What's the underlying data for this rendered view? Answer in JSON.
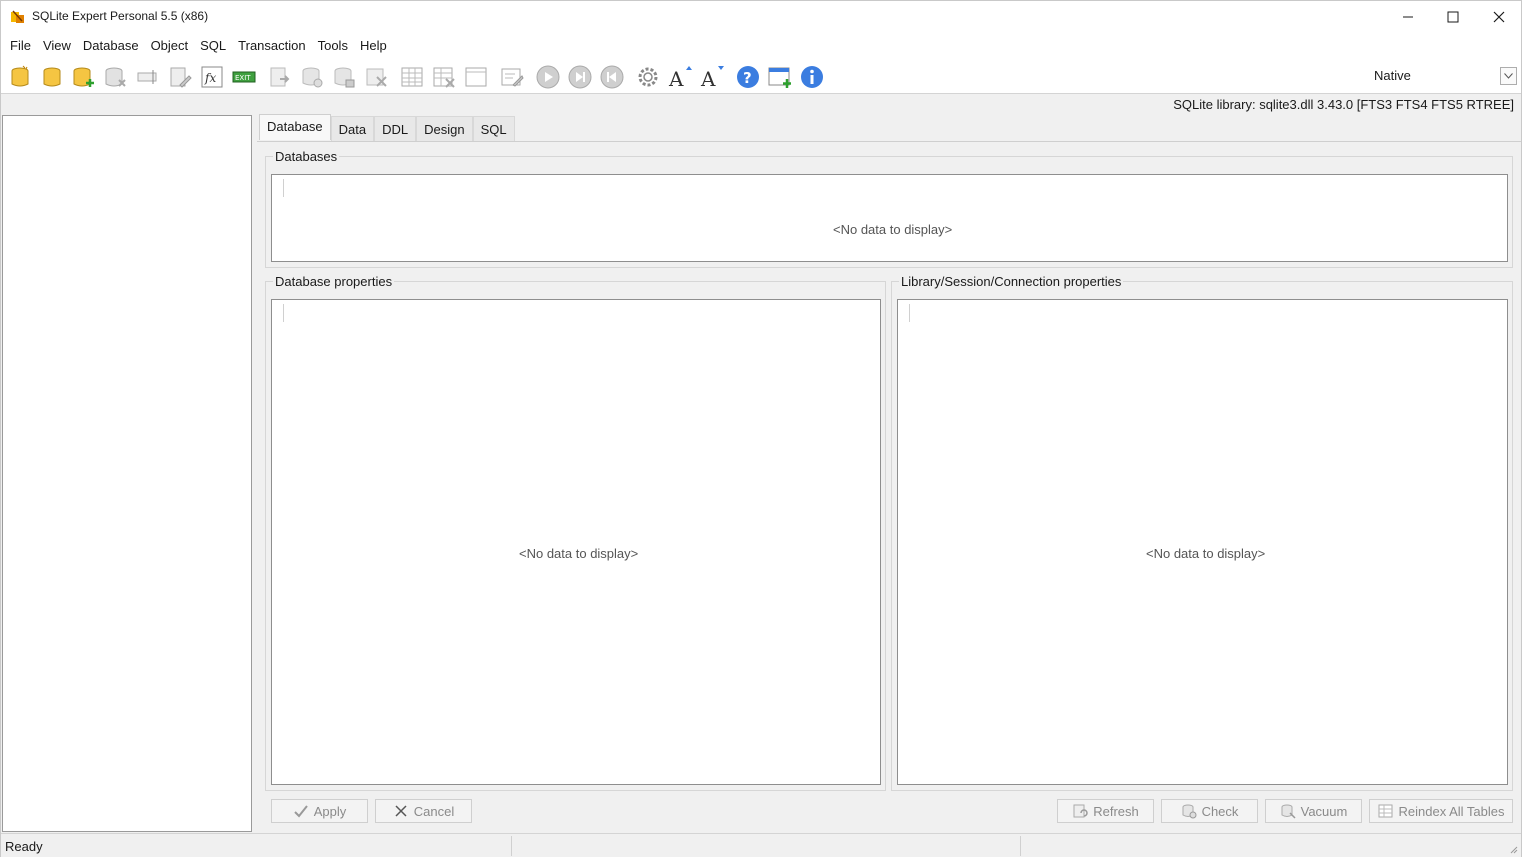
{
  "window": {
    "title": "SQLite Expert Personal 5.5 (x86)"
  },
  "menu": [
    "File",
    "View",
    "Database",
    "Object",
    "SQL",
    "Transaction",
    "Tools",
    "Help"
  ],
  "toolbar": {
    "icons": [
      "new-database-icon",
      "open-database-icon",
      "attach-database-icon",
      "detach-database-icon",
      "rename-icon",
      "edit-icon",
      "function-icon",
      "exit-icon",
      "import-icon",
      "backup-icon",
      "secure-icon",
      "sql-script-icon",
      "new-table-icon",
      "drop-table-icon",
      "new-view-icon",
      "edit-view-icon",
      "play-icon",
      "step-forward-icon",
      "step-back-icon",
      "settings-icon",
      "font-increase-icon",
      "font-decrease-icon",
      "help-icon",
      "add-window-icon",
      "info-icon"
    ],
    "mode_value": "Native"
  },
  "library_info": "SQLite library: sqlite3.dll 3.43.0 [FTS3 FTS4 FTS5 RTREE]",
  "tabs": [
    "Database",
    "Data",
    "DDL",
    "Design",
    "SQL"
  ],
  "active_tab": "Database",
  "groups": {
    "databases": {
      "title": "Databases",
      "empty": "<No data to display>"
    },
    "db_props": {
      "title": "Database properties",
      "empty": "<No data to display>"
    },
    "lib_props": {
      "title": "Library/Session/Connection properties",
      "empty": "<No data to display>"
    }
  },
  "buttons": {
    "apply": "Apply",
    "cancel": "Cancel",
    "refresh": "Refresh",
    "check": "Check",
    "vacuum": "Vacuum",
    "reindex": "Reindex All Tables"
  },
  "status": {
    "text": "Ready"
  },
  "colors": {
    "db_yellow": "#f5c542",
    "play_gray": "#b8b8b8",
    "help_blue": "#3b7de0",
    "window_bg": "#f0f0f0"
  }
}
